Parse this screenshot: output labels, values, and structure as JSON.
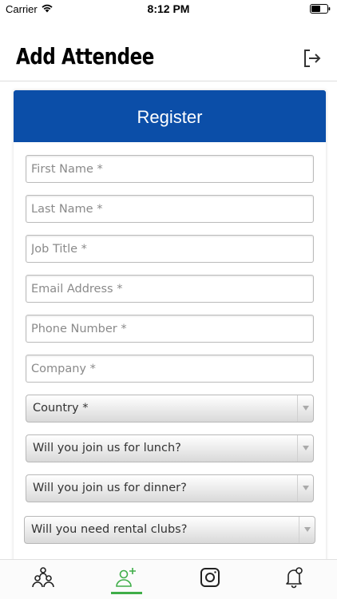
{
  "status_bar": {
    "carrier": "Carrier",
    "time": "8:12 PM"
  },
  "header": {
    "title": "Add Attendee",
    "logout_icon": "logout-icon"
  },
  "form": {
    "title": "Register",
    "header_color": "#0b4ea8",
    "fields": [
      {
        "placeholder": "First Name *",
        "value": ""
      },
      {
        "placeholder": "Last Name *",
        "value": ""
      },
      {
        "placeholder": "Job Title *",
        "value": ""
      },
      {
        "placeholder": "Email Address *",
        "value": ""
      },
      {
        "placeholder": "Phone Number *",
        "value": ""
      },
      {
        "placeholder": "Company *",
        "value": ""
      }
    ],
    "selects": [
      {
        "label": "Country *"
      },
      {
        "label": "Will you join us for lunch?"
      },
      {
        "label": "Will you join us for dinner?"
      },
      {
        "label": "Will you need rental clubs?"
      }
    ]
  },
  "tab_bar": {
    "active_color": "#3fae49",
    "tabs": [
      {
        "icon": "attendees-icon",
        "active": false
      },
      {
        "icon": "add-attendee-icon",
        "active": true
      },
      {
        "icon": "instagram-icon",
        "active": false
      },
      {
        "icon": "notification-bell-icon",
        "active": false
      }
    ]
  }
}
